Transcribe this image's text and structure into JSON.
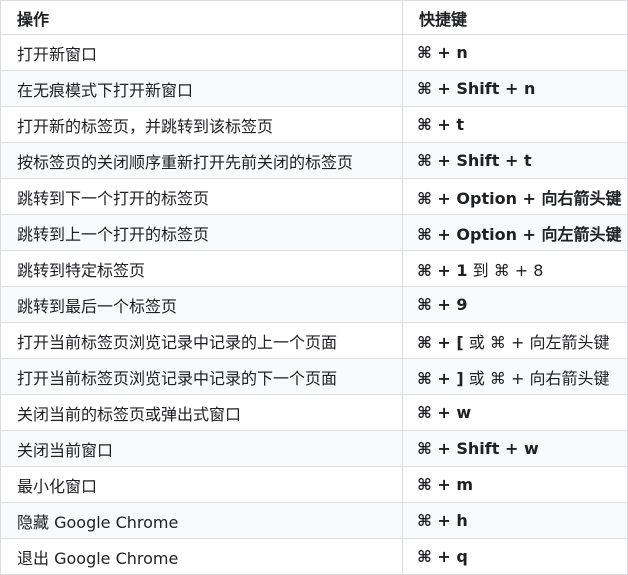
{
  "headers": {
    "action": "操作",
    "shortcut": "快捷键"
  },
  "rows": [
    {
      "action": "打开新窗口",
      "shortcut": [
        {
          "t": "⌘ + n",
          "b": true
        }
      ]
    },
    {
      "action": "在无痕模式下打开新窗口",
      "shortcut": [
        {
          "t": "⌘ + Shift + n",
          "b": true
        }
      ]
    },
    {
      "action": "打开新的标签页，并跳转到该标签页",
      "shortcut": [
        {
          "t": "⌘ + t",
          "b": true
        }
      ]
    },
    {
      "action": "按标签页的关闭顺序重新打开先前关闭的标签页",
      "shortcut": [
        {
          "t": "⌘ + Shift + t",
          "b": true
        }
      ]
    },
    {
      "action": "跳转到下一个打开的标签页",
      "shortcut": [
        {
          "t": "⌘ + Option + 向右箭头键",
          "b": true
        }
      ]
    },
    {
      "action": "跳转到上一个打开的标签页",
      "shortcut": [
        {
          "t": "⌘ + Option + 向左箭头键",
          "b": true
        }
      ]
    },
    {
      "action": "跳转到特定标签页",
      "shortcut": [
        {
          "t": "⌘ + 1",
          "b": true
        },
        {
          "t": " 到 ⌘ + 8",
          "b": false
        }
      ]
    },
    {
      "action": "跳转到最后一个标签页",
      "shortcut": [
        {
          "t": "⌘ + 9",
          "b": true
        }
      ]
    },
    {
      "action": "打开当前标签页浏览记录中记录的上一个页面",
      "shortcut": [
        {
          "t": "⌘ + [",
          "b": true
        },
        {
          "t": " 或 ⌘ + 向左箭头键",
          "b": false
        }
      ]
    },
    {
      "action": "打开当前标签页浏览记录中记录的下一个页面",
      "shortcut": [
        {
          "t": "⌘ + ]",
          "b": true
        },
        {
          "t": " 或 ⌘ + 向右箭头键",
          "b": false
        }
      ]
    },
    {
      "action": "关闭当前的标签页或弹出式窗口",
      "shortcut": [
        {
          "t": "⌘ + w",
          "b": true
        }
      ]
    },
    {
      "action": "关闭当前窗口",
      "shortcut": [
        {
          "t": "⌘ + Shift + w",
          "b": true
        }
      ]
    },
    {
      "action": "最小化窗口",
      "shortcut": [
        {
          "t": "⌘ + m",
          "b": true
        }
      ]
    },
    {
      "action": "隐藏 Google Chrome",
      "shortcut": [
        {
          "t": "⌘ + h",
          "b": true
        }
      ]
    },
    {
      "action": "退出 Google Chrome",
      "shortcut": [
        {
          "t": "⌘ + q",
          "b": true
        }
      ]
    }
  ]
}
